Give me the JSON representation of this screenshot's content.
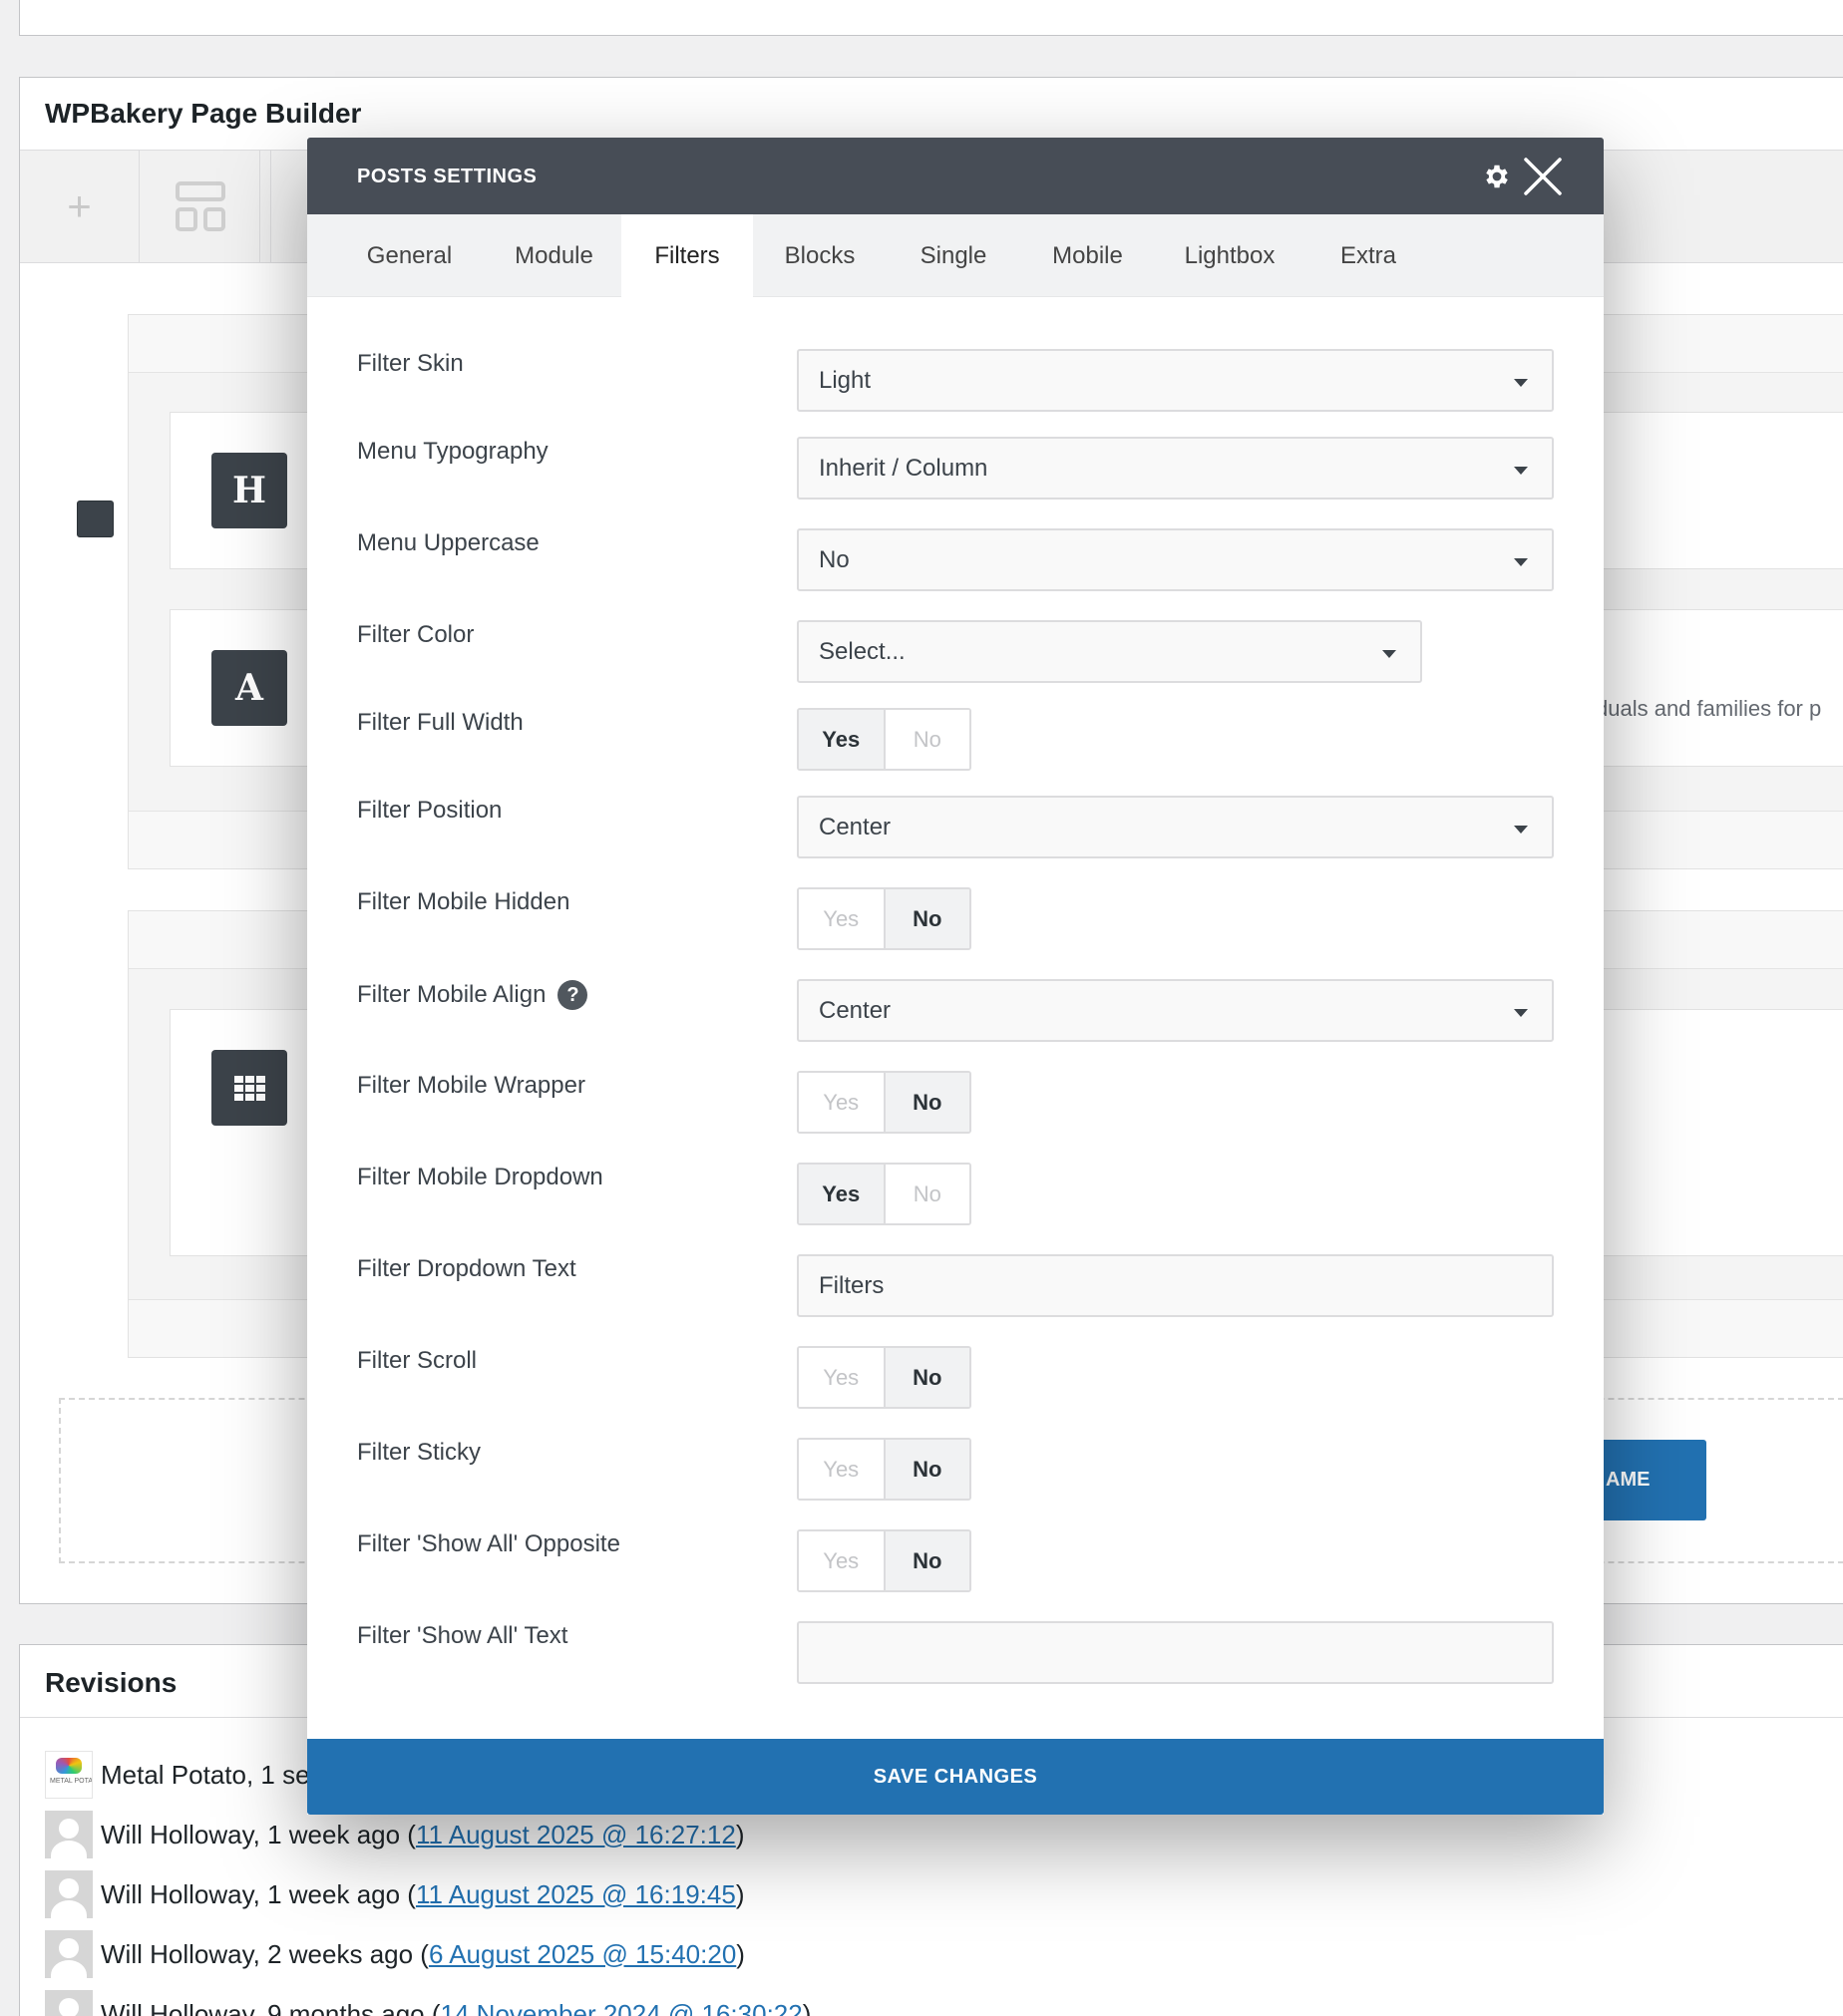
{
  "wpbakery": {
    "title": "WPBakery Page Builder",
    "add_icon": "plus-icon",
    "layout_icon": "layout-icon",
    "element_icons": [
      "H",
      "A",
      "grid-icon"
    ],
    "background_snippet": "duals and families for p",
    "partial_button_label": "AME"
  },
  "revisions": {
    "title": "Revisions",
    "items": [
      {
        "author": "Metal Potato, 1 se",
        "link": ""
      },
      {
        "author": "Will Holloway, 1 week ago (",
        "link": "11 August 2025 @ 16:27:12",
        "suffix": ")"
      },
      {
        "author": "Will Holloway, 1 week ago (",
        "link": "11 August 2025 @ 16:19:45",
        "suffix": ")"
      },
      {
        "author": "Will Holloway, 2 weeks ago (",
        "link": "6 August 2025 @ 15:40:20",
        "suffix": ")"
      },
      {
        "author": "Will Holloway, 9 months ago (",
        "link": "14 November 2024 @ 16:30:22",
        "suffix": ")"
      }
    ]
  },
  "modal": {
    "title": "POSTS SETTINGS",
    "gear_icon": "gear-icon",
    "close_icon": "close-icon",
    "tabs": [
      {
        "label": "General"
      },
      {
        "label": "Module"
      },
      {
        "label": "Filters",
        "active": true
      },
      {
        "label": "Blocks"
      },
      {
        "label": "Single"
      },
      {
        "label": "Mobile"
      },
      {
        "label": "Lightbox"
      },
      {
        "label": "Extra"
      }
    ],
    "fields": {
      "filter_skin": {
        "label": "Filter Skin",
        "value": "Light"
      },
      "menu_typography": {
        "label": "Menu Typography",
        "value": "Inherit / Column"
      },
      "menu_uppercase": {
        "label": "Menu Uppercase",
        "value": "No"
      },
      "filter_color": {
        "label": "Filter Color",
        "value": "Select..."
      },
      "filter_full_width": {
        "label": "Filter Full Width",
        "yes": "Yes",
        "no": "No",
        "selected": "Yes"
      },
      "filter_position": {
        "label": "Filter Position",
        "value": "Center"
      },
      "filter_mobile_hidden": {
        "label": "Filter Mobile Hidden",
        "yes": "Yes",
        "no": "No",
        "selected": "No"
      },
      "filter_mobile_align": {
        "label": "Filter Mobile Align",
        "value": "Center",
        "help": "?"
      },
      "filter_mobile_wrapper": {
        "label": "Filter Mobile Wrapper",
        "yes": "Yes",
        "no": "No",
        "selected": "No"
      },
      "filter_mobile_dropdown": {
        "label": "Filter Mobile Dropdown",
        "yes": "Yes",
        "no": "No",
        "selected": "Yes"
      },
      "filter_dropdown_text": {
        "label": "Filter Dropdown Text",
        "value": "Filters"
      },
      "filter_scroll": {
        "label": "Filter Scroll",
        "yes": "Yes",
        "no": "No",
        "selected": "No"
      },
      "filter_sticky": {
        "label": "Filter Sticky",
        "yes": "Yes",
        "no": "No",
        "selected": "No"
      },
      "filter_show_all_opposite": {
        "label": "Filter 'Show All' Opposite",
        "yes": "Yes",
        "no": "No",
        "selected": "No"
      },
      "filter_show_all_text": {
        "label": "Filter 'Show All' Text",
        "value": ""
      }
    },
    "save_label": "SAVE CHANGES"
  },
  "colors": {
    "modal_header": "#474d56",
    "accent_blue": "#2271b1",
    "element_icon": "#3c434a"
  }
}
